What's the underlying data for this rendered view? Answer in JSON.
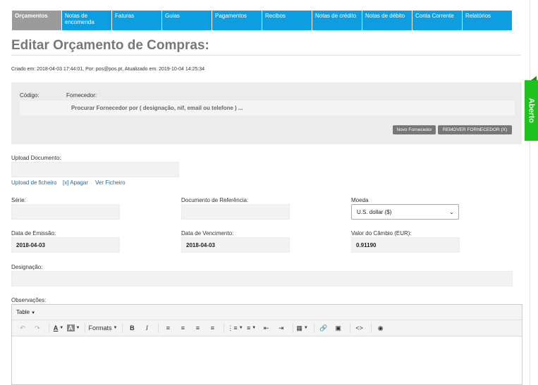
{
  "tabs": [
    {
      "label": "Orçamentos",
      "active": true
    },
    {
      "label": "Notas de encomenda",
      "active": false
    },
    {
      "label": "Faturas",
      "active": false
    },
    {
      "label": "Guias",
      "active": false
    },
    {
      "label": "Pagamentos",
      "active": false
    },
    {
      "label": "Recibos",
      "active": false
    },
    {
      "label": "Notas de crédito",
      "active": false
    },
    {
      "label": "Notas de débito",
      "active": false
    },
    {
      "label": "Conta Corrente",
      "active": false
    },
    {
      "label": "Relatórios",
      "active": false
    }
  ],
  "page": {
    "title": "Editar Orçamento de Compras:",
    "meta": "Criado em: 2018-04-03 17:44:01, Por: pos@pos.pt, Atualizado em: 2019-10-04 14:25:34"
  },
  "supplier": {
    "code_label": "Código:",
    "supplier_label": "Fornecedor:",
    "search_placeholder": "Procurar Fornecedor por ( designação, nif, email ou telefone ) ...",
    "new_button": "Novo Fornecedor",
    "remove_button": "REMOVER FORNECEDOR (X)"
  },
  "upload": {
    "label": "Upload Documento:",
    "upload_link": "Upload de ficheiro",
    "delete_link": "[x] Apagar",
    "view_link": "Ver Ficheiro"
  },
  "form": {
    "serie_label": "Série:",
    "serie_value": "",
    "ref_label": "Documento de Referência:",
    "ref_value": "",
    "currency_label": "Moeda",
    "currency_value": "U.S. dollar ($)",
    "emission_label": "Data de Emissão:",
    "emission_value": "2018-04-03",
    "due_label": "Data de Vencimento:",
    "due_value": "2018-04-03",
    "rate_label": "Valor do Câmbio (EUR):",
    "rate_value": "0.91190",
    "designation_label": "Designação:",
    "designation_value": "",
    "notes_label": "Observações:"
  },
  "editor": {
    "menu_table": "Table",
    "formats": "Formats"
  },
  "status": {
    "label": "Aberto",
    "color": "#1ec31e"
  }
}
